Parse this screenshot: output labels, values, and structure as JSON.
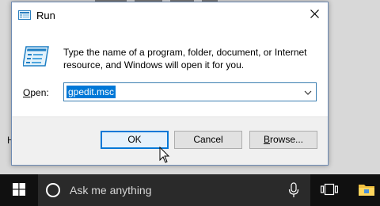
{
  "dialog": {
    "title": "Run",
    "message": "Type the name of a program, folder, document, or Internet resource, and Windows will open it for you.",
    "open_label_prefix": "",
    "open_label_hotkey": "O",
    "open_label_rest": "pen:",
    "open_value": "gpedit.msc",
    "buttons": {
      "ok": "OK",
      "cancel": "Cancel",
      "browse_hotkey": "B",
      "browse_rest": "rowse..."
    }
  },
  "taskbar": {
    "search_placeholder": "Ask me anything"
  },
  "desktop": {
    "partial_label": "H"
  },
  "icons": {
    "title": "run-icon",
    "close": "close-icon",
    "big": "run-large-icon",
    "combo_arrow": "chevron-down-icon",
    "start": "windows-logo-icon",
    "search": "cortana-circle-icon",
    "mic": "microphone-icon",
    "taskview": "task-view-icon",
    "explorer": "folder-icon",
    "cursor": "mouse-pointer-icon"
  },
  "colors": {
    "accent": "#0078d7",
    "taskbar": "#101010",
    "footer": "#f0f0f0"
  }
}
